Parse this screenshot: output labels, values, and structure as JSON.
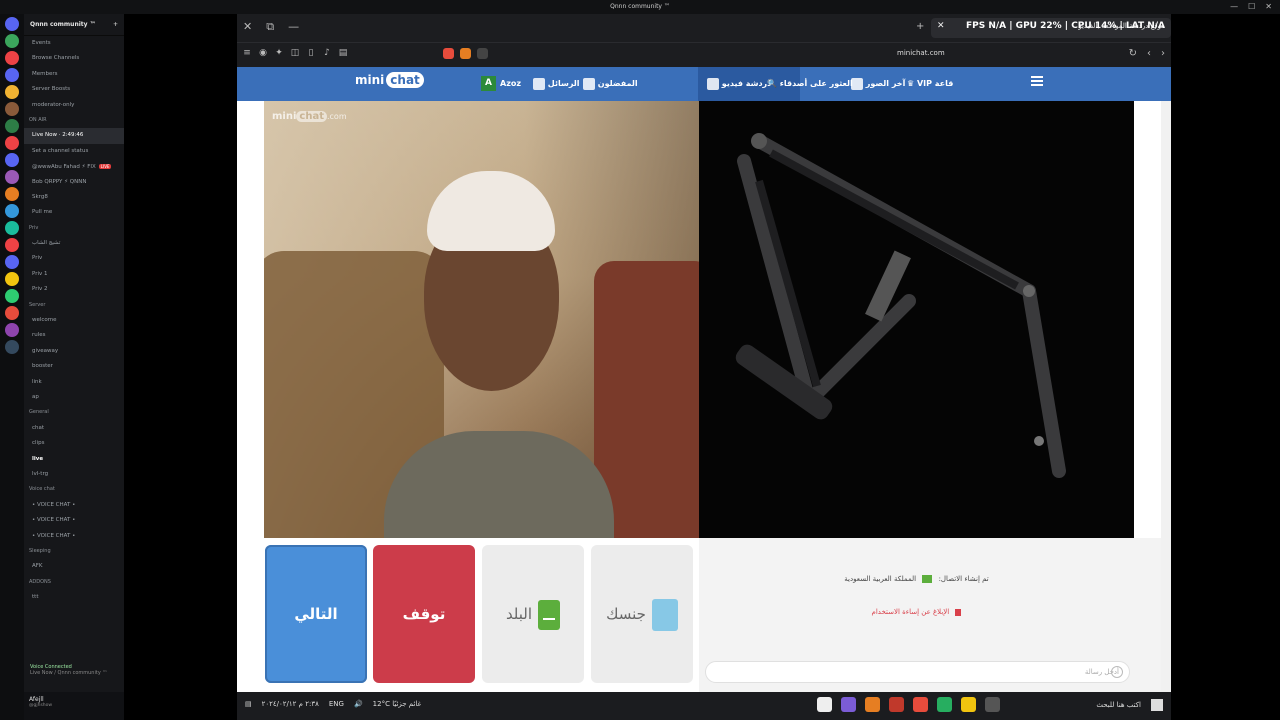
{
  "os": {
    "window_title": "Qnnn community ™"
  },
  "discord": {
    "server_name": "Qnnn community ™",
    "channels": [
      {
        "label": "Events",
        "kind": "item"
      },
      {
        "label": "Browse Channels",
        "kind": "item"
      },
      {
        "label": "Members",
        "kind": "item"
      },
      {
        "label": "Server Boosts",
        "kind": "item"
      },
      {
        "label": "moderator-only",
        "kind": "item"
      },
      {
        "label": "ON AIR",
        "kind": "cat"
      },
      {
        "label": "Live Now · 2:49:46",
        "kind": "active"
      },
      {
        "label": "Set a channel status",
        "kind": "item"
      },
      {
        "label": "@wwwAbu Fahad ⚡ FIX",
        "kind": "live"
      },
      {
        "label": "Bob QRPPY ⚡ QNNN",
        "kind": "item"
      },
      {
        "label": "Skrg8",
        "kind": "item"
      },
      {
        "label": "Pull me",
        "kind": "item"
      },
      {
        "label": "Priv",
        "kind": "cat"
      },
      {
        "label": "تشيج الشاب",
        "kind": "item"
      },
      {
        "label": "Priv",
        "kind": "item"
      },
      {
        "label": "Priv 1",
        "kind": "item"
      },
      {
        "label": "Priv 2",
        "kind": "item"
      },
      {
        "label": "Server",
        "kind": "cat"
      },
      {
        "label": "welcome",
        "kind": "item"
      },
      {
        "label": "rules",
        "kind": "item"
      },
      {
        "label": "giveaway",
        "kind": "item"
      },
      {
        "label": "booster",
        "kind": "item"
      },
      {
        "label": "link",
        "kind": "item"
      },
      {
        "label": "ap",
        "kind": "item"
      },
      {
        "label": "General",
        "kind": "cat"
      },
      {
        "label": "chat",
        "kind": "item"
      },
      {
        "label": "clips",
        "kind": "item"
      },
      {
        "label": "live",
        "kind": "bold"
      },
      {
        "label": "lvl-trg",
        "kind": "item"
      },
      {
        "label": "Voice chat",
        "kind": "cat"
      },
      {
        "label": "• VOICE CHAT •",
        "kind": "item"
      },
      {
        "label": "• VOICE CHAT •",
        "kind": "item"
      },
      {
        "label": "• VOICE CHAT •",
        "kind": "item"
      },
      {
        "label": "Sleeping",
        "kind": "cat"
      },
      {
        "label": "AFK",
        "kind": "item"
      },
      {
        "label": "ADDONS",
        "kind": "cat"
      },
      {
        "label": "ttt",
        "kind": "item"
      }
    ],
    "live_badge": "LIVE",
    "voice": {
      "title": "Voice Connected",
      "sub": "Live Now / Qnnn community ™"
    },
    "user": {
      "name": "Afejll",
      "status": "@gjhshow"
    }
  },
  "browser": {
    "tab_title": "موقع دردشة المواعدة بالفيديو",
    "stats": "FPS N/A  |  GPU 22%  |  CPU 14%  |  LAT N/A",
    "url": "minichat.com"
  },
  "minichat": {
    "logo_mini": "mini",
    "logo_chat": "chat",
    "nav": {
      "user_initial": "A",
      "user_name": "Azoz",
      "messages": "الرسائل",
      "favorites": "المفضلون",
      "video_chat": "دردشة فيديو",
      "friends": "العثور على أصدقاء",
      "photos": "آخر الصور",
      "vip": "VIP قاعة"
    },
    "watermark": {
      "mini": "mini",
      "chat": "chat",
      "domain": ".com"
    },
    "buttons": {
      "next": "التالي",
      "stop": "توقف",
      "country": "البلد",
      "gender": "جنسك"
    },
    "chat": {
      "connection": "تم إنشاء الاتصال:",
      "country": "المملكة العربية السعودية",
      "report": "الإبلاغ عن إساءة الاستخدام",
      "placeholder": "أدخل رسالة"
    }
  },
  "taskbar": {
    "clock_time": "٢:٣٨ م",
    "clock_date": "٢٠٢٤/٠٢/١٢",
    "lang": "ENG",
    "weather": "12°C  غائم جزئيًا",
    "search": "اكتب هنا للبحث"
  }
}
